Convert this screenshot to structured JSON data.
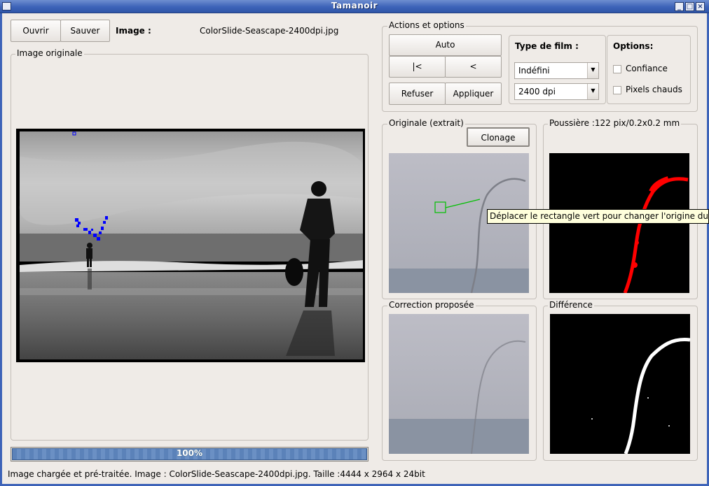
{
  "window": {
    "title": "Tamanoir"
  },
  "toolbar": {
    "open_label": "Ouvrir",
    "save_label": "Sauver",
    "image_label": "Image :",
    "filename": "ColorSlide-Seascape-2400dpi.jpg"
  },
  "original": {
    "group_label": "Image originale"
  },
  "actions": {
    "group_label": "Actions et options",
    "auto_label": "Auto",
    "first_label": "|<",
    "prev_label": "<",
    "refuse_label": "Refuser",
    "apply_label": "Appliquer"
  },
  "film": {
    "label": "Type de film :",
    "type_value": "Indéfini",
    "dpi_value": "2400 dpi"
  },
  "options": {
    "label": "Options:",
    "confidence_label": "Confiance",
    "hot_pixels_label": "Pixels chauds"
  },
  "crop": {
    "label": "Originale (extrait)",
    "clone_label": "Clonage"
  },
  "dust": {
    "label": "Poussière :122 pix/0.2x0.2 mm"
  },
  "correction": {
    "label": "Correction proposée"
  },
  "difference": {
    "label": "Différence"
  },
  "tooltip": {
    "text": "Déplacer le rectangle vert pour changer l'origine du clonage"
  },
  "progress": {
    "percent": 100,
    "text": "100%"
  },
  "status": {
    "text": "Image chargée et pré-traitée. Image : ColorSlide-Seascape-2400dpi.jpg. Taille :4444 x 2964 x 24bit"
  },
  "colors": {
    "titlebar": "#3d63b8",
    "dust_mask": "#ff0000",
    "clone_rect": "#00c000",
    "detection": "#0000ff"
  }
}
